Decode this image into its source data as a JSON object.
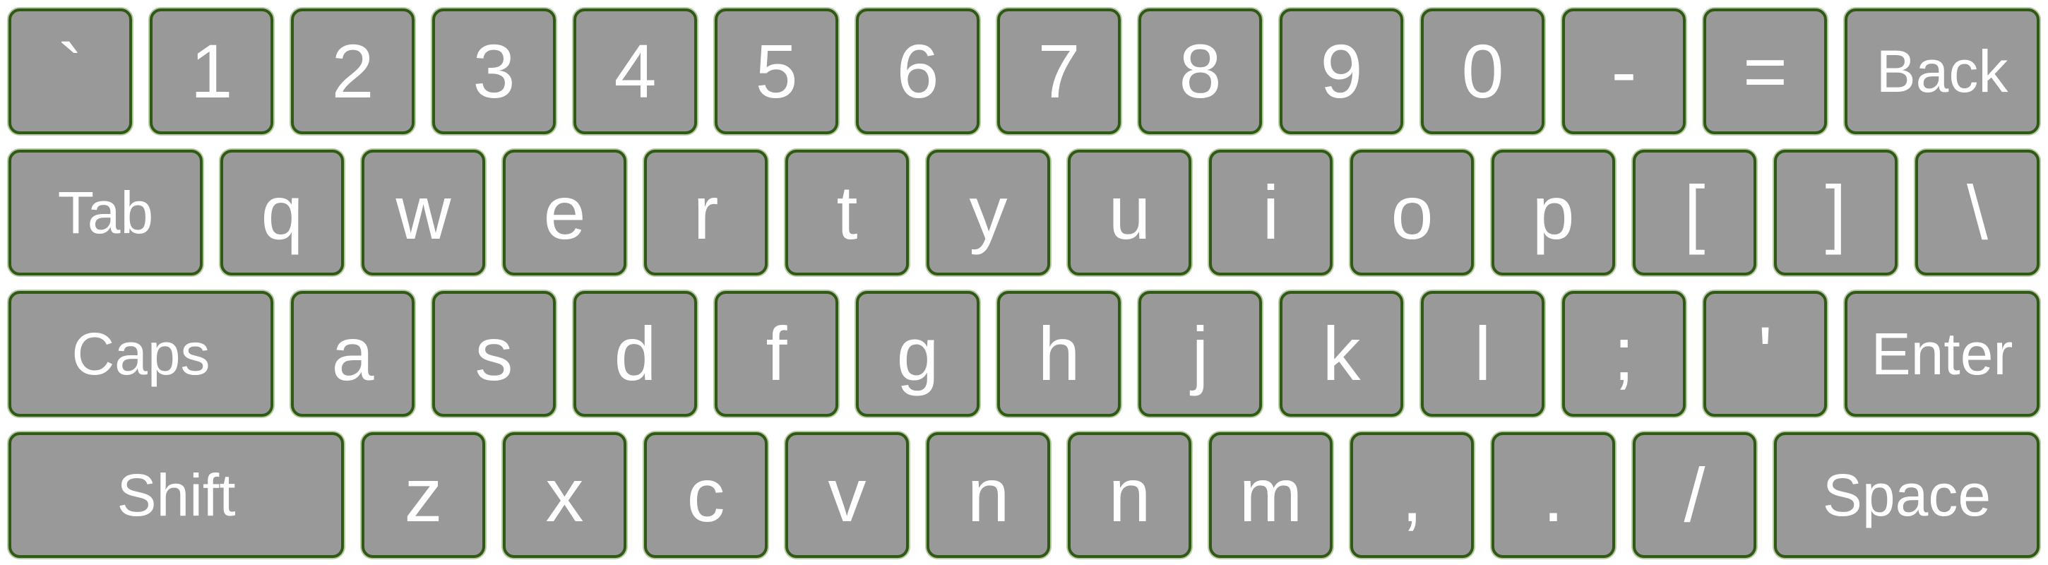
{
  "keyboard": {
    "rows": [
      {
        "name": "number-row",
        "keys": [
          {
            "label": "`",
            "id": "backtick"
          },
          {
            "label": "1",
            "id": "1"
          },
          {
            "label": "2",
            "id": "2"
          },
          {
            "label": "3",
            "id": "3"
          },
          {
            "label": "4",
            "id": "4"
          },
          {
            "label": "5",
            "id": "5"
          },
          {
            "label": "6",
            "id": "6"
          },
          {
            "label": "7",
            "id": "7"
          },
          {
            "label": "8",
            "id": "8"
          },
          {
            "label": "9",
            "id": "9"
          },
          {
            "label": "0",
            "id": "0"
          },
          {
            "label": "-",
            "id": "minus"
          },
          {
            "label": "=",
            "id": "equals"
          },
          {
            "label": "Back",
            "id": "back",
            "kind": "word"
          }
        ]
      },
      {
        "name": "top-row",
        "keys": [
          {
            "label": "Tab",
            "id": "tab",
            "kind": "word"
          },
          {
            "label": "q",
            "id": "q"
          },
          {
            "label": "w",
            "id": "w"
          },
          {
            "label": "e",
            "id": "e"
          },
          {
            "label": "r",
            "id": "r"
          },
          {
            "label": "t",
            "id": "t"
          },
          {
            "label": "y",
            "id": "y"
          },
          {
            "label": "u",
            "id": "u"
          },
          {
            "label": "i",
            "id": "i"
          },
          {
            "label": "o",
            "id": "o"
          },
          {
            "label": "p",
            "id": "p"
          },
          {
            "label": "[",
            "id": "left-bracket"
          },
          {
            "label": "]",
            "id": "right-bracket"
          },
          {
            "label": "\\",
            "id": "backslash"
          }
        ]
      },
      {
        "name": "home-row",
        "keys": [
          {
            "label": "Caps",
            "id": "caps",
            "kind": "word"
          },
          {
            "label": "a",
            "id": "a"
          },
          {
            "label": "s",
            "id": "s"
          },
          {
            "label": "d",
            "id": "d"
          },
          {
            "label": "f",
            "id": "f"
          },
          {
            "label": "g",
            "id": "g"
          },
          {
            "label": "h",
            "id": "h"
          },
          {
            "label": "j",
            "id": "j"
          },
          {
            "label": "k",
            "id": "k"
          },
          {
            "label": "l",
            "id": "l"
          },
          {
            "label": ";",
            "id": "semicolon"
          },
          {
            "label": "'",
            "id": "quote"
          },
          {
            "label": "Enter",
            "id": "enter",
            "kind": "word"
          }
        ]
      },
      {
        "name": "bottom-row",
        "keys": [
          {
            "label": "Shift",
            "id": "shift",
            "kind": "word"
          },
          {
            "label": "z",
            "id": "z"
          },
          {
            "label": "x",
            "id": "x"
          },
          {
            "label": "c",
            "id": "c"
          },
          {
            "label": "v",
            "id": "v"
          },
          {
            "label": "n",
            "id": "n-1"
          },
          {
            "label": "n",
            "id": "n-2"
          },
          {
            "label": "m",
            "id": "m"
          },
          {
            "label": ",",
            "id": "comma"
          },
          {
            "label": ".",
            "id": "period"
          },
          {
            "label": "/",
            "id": "slash"
          },
          {
            "label": "Space",
            "id": "space",
            "kind": "word"
          }
        ]
      }
    ]
  },
  "colors": {
    "key_fill": "#999999",
    "key_border": "#2f5a13",
    "key_text": "#ffffff",
    "background": "#ffffff"
  }
}
